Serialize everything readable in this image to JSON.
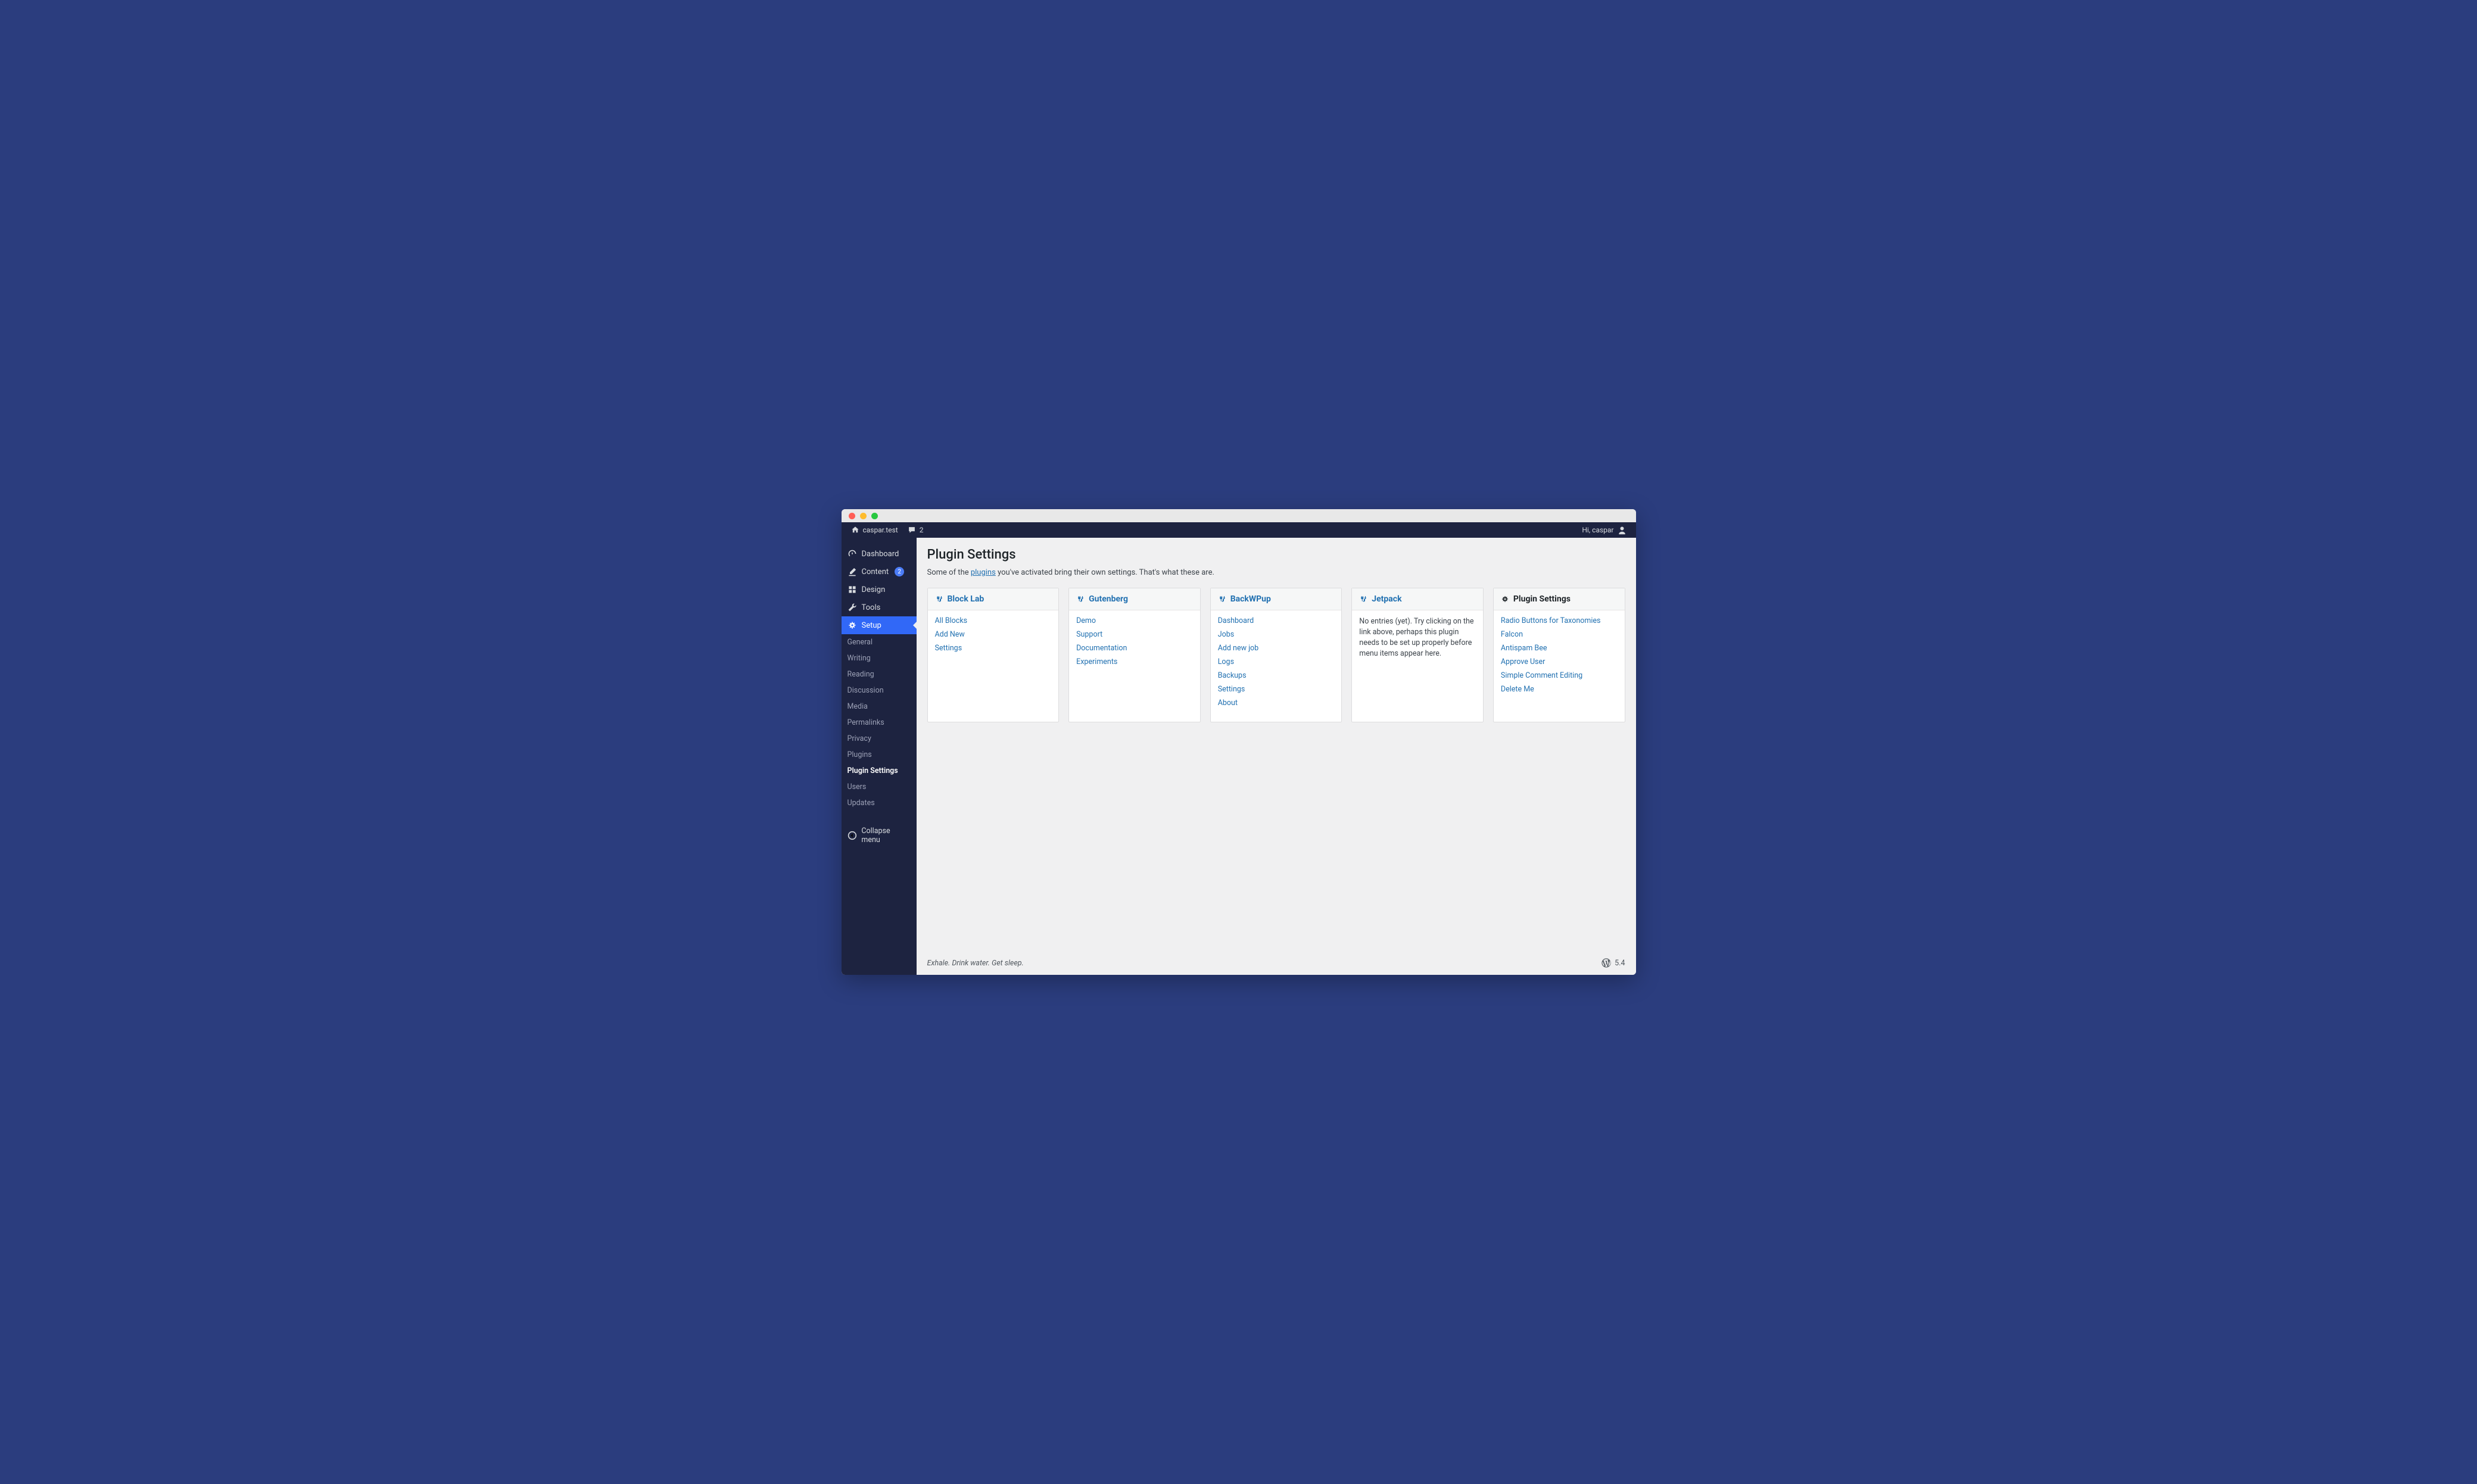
{
  "adminbar": {
    "site_name": "caspar.test",
    "comments_count": "2",
    "greeting": "Hi, caspar"
  },
  "sidebar": {
    "top": [
      {
        "id": "dashboard",
        "label": "Dashboard",
        "icon": "dashboard"
      },
      {
        "id": "content",
        "label": "Content",
        "icon": "edit",
        "badge": "2"
      },
      {
        "id": "design",
        "label": "Design",
        "icon": "appearance"
      },
      {
        "id": "tools",
        "label": "Tools",
        "icon": "tools"
      },
      {
        "id": "setup",
        "label": "Setup",
        "icon": "settings",
        "active": true
      }
    ],
    "sub": [
      {
        "id": "general",
        "label": "General"
      },
      {
        "id": "writing",
        "label": "Writing"
      },
      {
        "id": "reading",
        "label": "Reading"
      },
      {
        "id": "discussion",
        "label": "Discussion"
      },
      {
        "id": "media",
        "label": "Media"
      },
      {
        "id": "permalinks",
        "label": "Permalinks"
      },
      {
        "id": "privacy",
        "label": "Privacy"
      },
      {
        "id": "plugins",
        "label": "Plugins"
      },
      {
        "id": "plugin-settings",
        "label": "Plugin Settings",
        "current": true
      },
      {
        "id": "users",
        "label": "Users"
      },
      {
        "id": "updates",
        "label": "Updates"
      }
    ],
    "collapse_label": "Collapse menu"
  },
  "page": {
    "title": "Plugin Settings",
    "desc_before": "Some of the ",
    "desc_link": "plugins",
    "desc_after": " you've activated bring their own settings. That's what these are."
  },
  "cards": [
    {
      "id": "block-lab",
      "title": "Block Lab",
      "icon": "plug",
      "links": [
        "All Blocks",
        "Add New",
        "Settings"
      ]
    },
    {
      "id": "gutenberg",
      "title": "Gutenberg",
      "icon": "plug",
      "links": [
        "Demo",
        "Support",
        "Documentation",
        "Experiments"
      ]
    },
    {
      "id": "backwpup",
      "title": "BackWPup",
      "icon": "plug",
      "links": [
        "Dashboard",
        "Jobs",
        "Add new job",
        "Logs",
        "Backups",
        "Settings",
        "About"
      ]
    },
    {
      "id": "jetpack",
      "title": "Jetpack",
      "icon": "plug",
      "empty": "No entries (yet). Try clicking on the link above, perhaps this plugin needs to be set up properly before menu items appear here."
    },
    {
      "id": "plugin-settings",
      "title": "Plugin Settings",
      "icon": "settings",
      "nolink": true,
      "links": [
        "Radio Buttons for Taxonomies",
        "Falcon",
        "Antispam Bee",
        "Approve User",
        "Simple Comment Editing",
        "Delete Me"
      ]
    }
  ],
  "footer": {
    "left": "Exhale. Drink water. Get sleep.",
    "version": "5.4"
  }
}
